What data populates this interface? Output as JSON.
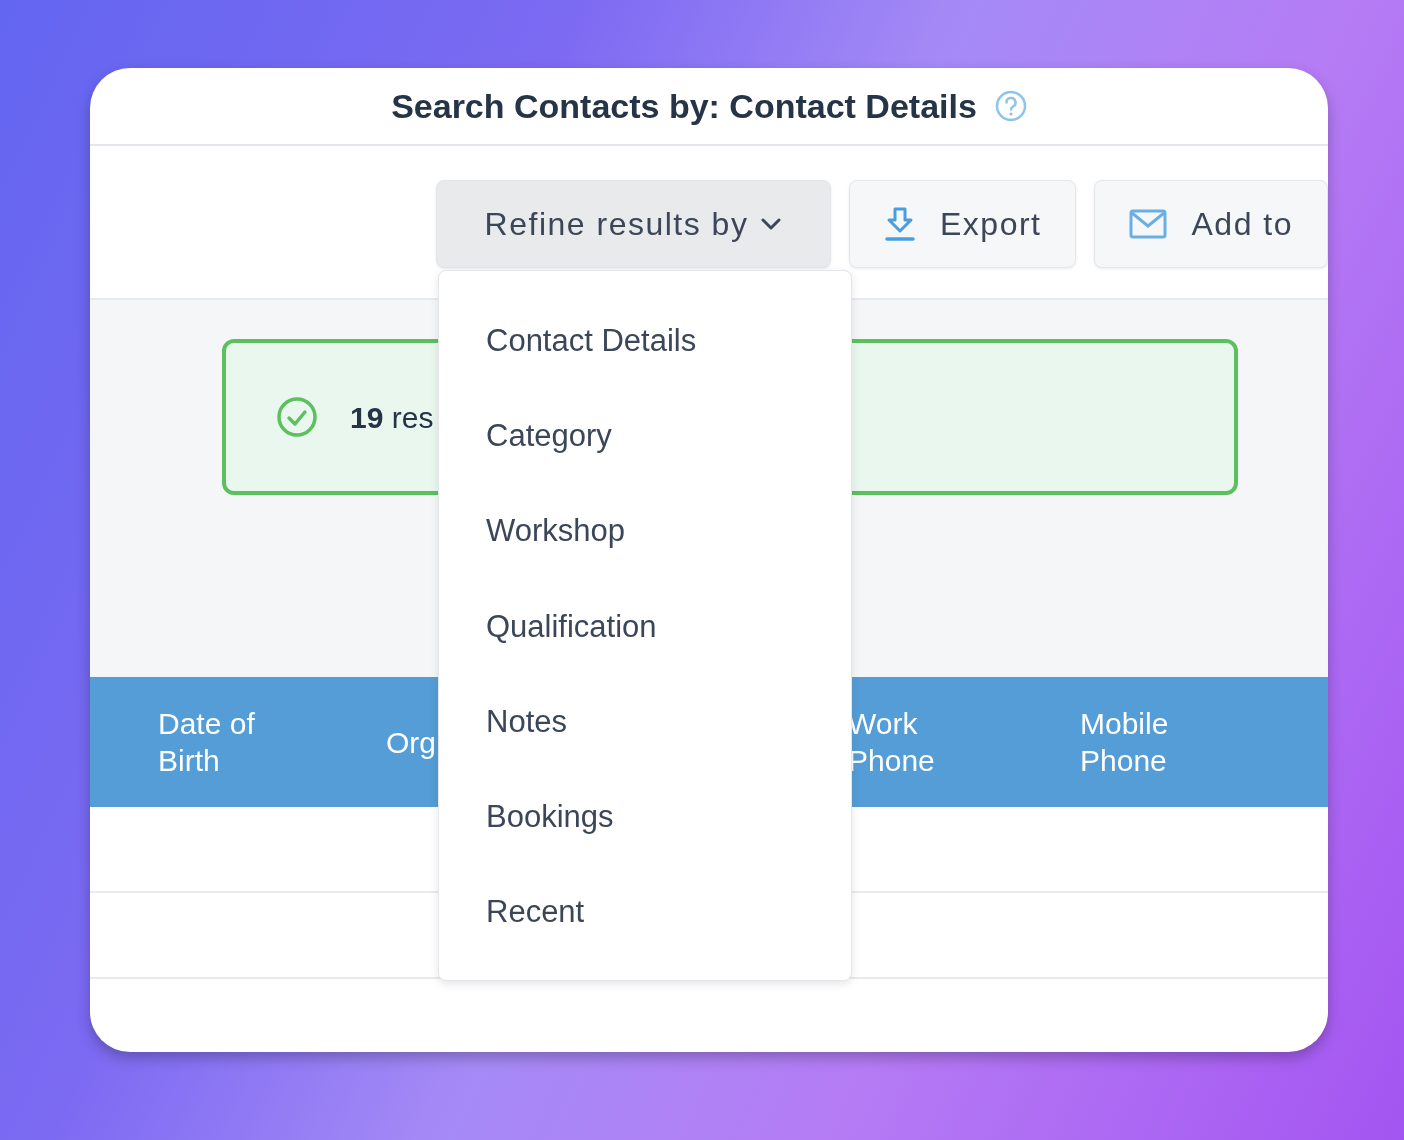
{
  "title": "Search Contacts by: Contact Details",
  "toolbar": [
    {
      "kind": "dropdown",
      "label": "Refine results by",
      "expanded": true
    },
    {
      "kind": "export",
      "label": "Export"
    },
    {
      "kind": "email",
      "label": "Add to"
    }
  ],
  "menu": [
    "Contact Details",
    "Category",
    "Workshop",
    "Qualification",
    "Notes",
    "Bookings",
    "Recent"
  ],
  "summary": {
    "text": "**19** res"
  },
  "table": {
    "columns": [
      "Date of\nBirth",
      "Org",
      "Work\nPhone",
      "Mobile\nPhone"
    ]
  }
}
